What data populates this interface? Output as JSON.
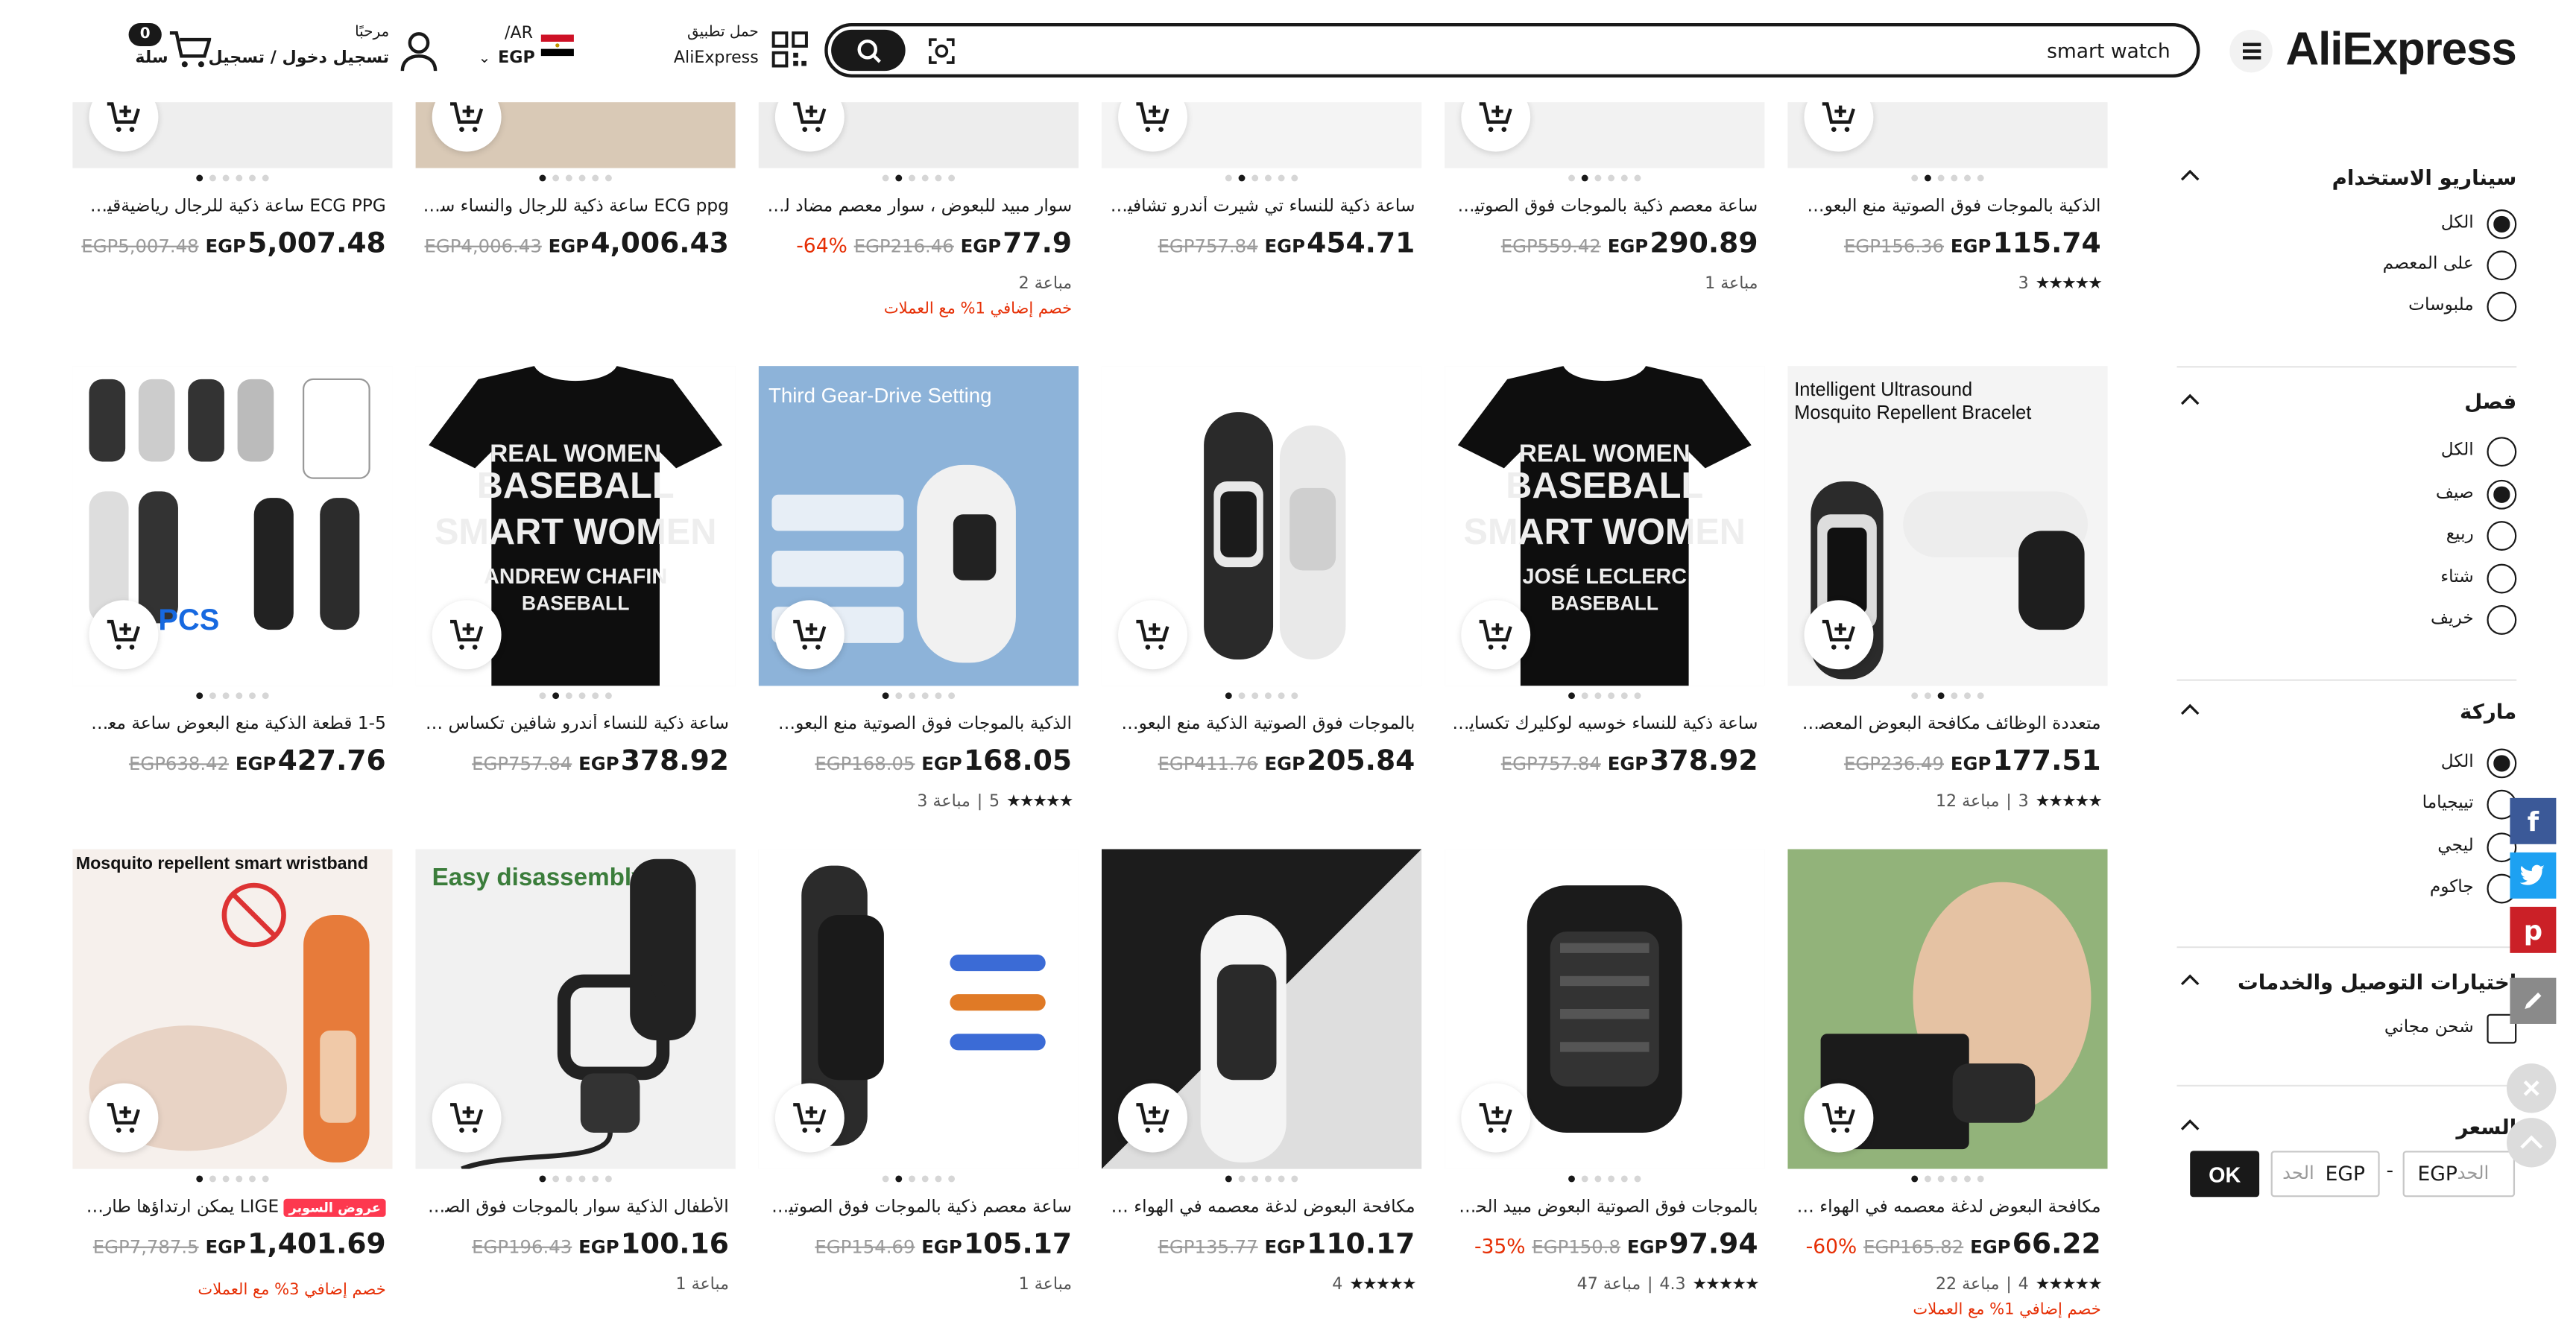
{
  "header": {
    "logo": "AliExpress",
    "search_value": "smart watch",
    "app_line1": "حمل تطبيق",
    "app_line2": "AliExpress",
    "lang_line1": "/AR",
    "lang_line2": "EGP",
    "welcome": "مرحبًا",
    "signin": "تسجيل دخول / تسجيل",
    "cart_count": "0",
    "cart_label": "سلة"
  },
  "filters": {
    "usage": {
      "title": "سيناريو الاستخدام",
      "options": [
        {
          "label": "الكل",
          "selected": true
        },
        {
          "label": "على المعصم",
          "selected": false
        },
        {
          "label": "ملبوسات",
          "selected": false
        }
      ]
    },
    "season": {
      "title": "فصل",
      "options": [
        {
          "label": "الكل",
          "selected": false
        },
        {
          "label": "صيف",
          "selected": true
        },
        {
          "label": "ربيع",
          "selected": false
        },
        {
          "label": "شتاء",
          "selected": false
        },
        {
          "label": "خريف",
          "selected": false
        }
      ]
    },
    "brand": {
      "title": "ماركة",
      "options": [
        {
          "label": "الكل",
          "selected": true
        },
        {
          "label": "تييجياما",
          "selected": false
        },
        {
          "label": "ليجي",
          "selected": false
        },
        {
          "label": "جاكوم",
          "selected": false
        }
      ]
    },
    "delivery": {
      "title": "اختيارات التوصيل والخدمات",
      "options": [
        {
          "label": "شحن مجاني",
          "selected": false
        }
      ]
    },
    "price": {
      "title": "السعر",
      "min_prefix": "EGP",
      "min_placeholder": "الحد",
      "max_prefix": "EGP",
      "max_placeholder": "الحد",
      "sep": "-",
      "ok": "OK"
    }
  },
  "products": [
    {
      "title": "الذكية بالموجات فوق الصوتية منع البعوض ...",
      "price": "115.74",
      "currency": "EGP",
      "old_price": "EGP156.36",
      "rating": "3",
      "sold": "",
      "discount": "",
      "promo": ""
    },
    {
      "title": "ساعة معصم ذكية بالموجات فوق الصوتية للأط",
      "price": "290.89",
      "currency": "EGP",
      "old_price": "EGP559.42",
      "rating": "",
      "sold": "1 مباعة",
      "discount": "",
      "promo": ""
    },
    {
      "title": "ساعة ذكية للنساء تي شيرت أندرو تشافين تك...",
      "price": "454.71",
      "currency": "EGP",
      "old_price": "EGP757.84",
      "rating": "",
      "sold": "",
      "discount": "",
      "promo": ""
    },
    {
      "title": "سوار مبيد للبعوض ، سوار معصم مضاد للبعـ...",
      "price": "77.9",
      "currency": "EGP",
      "old_price": "EGP216.46",
      "rating": "",
      "sold": "2 مباعة",
      "discount": "-64%",
      "promo": "خصم إضافي 1% مع العملات"
    },
    {
      "title": "ECG ppg ساعة ذكية للرجال والنساء ساعـ...",
      "price": "4,006.43",
      "currency": "EGP",
      "old_price": "EGP4,006.43",
      "rating": "",
      "sold": "",
      "discount": "",
      "promo": ""
    },
    {
      "title": "ECG PPG ساعة ذكية للرجال رياضيةقيق...",
      "price": "5,007.48",
      "currency": "EGP",
      "old_price": "EGP5,007.48",
      "rating": "",
      "sold": "",
      "discount": "",
      "promo": ""
    },
    {
      "title": "متعددة الوظائف مكافحة البعوض المعصم الق...",
      "price": "177.51",
      "currency": "EGP",
      "old_price": "EGP236.49",
      "rating": "3",
      "sold": "12 مباعة",
      "discount": "",
      "promo": ""
    },
    {
      "title": "ساعة ذكية للنساء خوسيه لوكليرك تكسايسيو...",
      "price": "378.92",
      "currency": "EGP",
      "old_price": "EGP757.84",
      "rating": "",
      "sold": "",
      "discount": "",
      "promo": ""
    },
    {
      "title": "بالموجات فوق الصوتية الذكية منع البعوض ...",
      "price": "205.84",
      "currency": "EGP",
      "old_price": "EGP411.76",
      "rating": "",
      "sold": "",
      "discount": "",
      "promo": ""
    },
    {
      "title": "الذكية بالموجات فوق الصوتية منع البعوض ...",
      "price": "168.05",
      "currency": "EGP",
      "old_price": "EGP168.05",
      "rating": "5",
      "sold": "3 مباعة",
      "discount": "",
      "promo": ""
    },
    {
      "title": "ساعة ذكية للنساء أندرو شافين تكساس بيسبو...",
      "price": "378.92",
      "currency": "EGP",
      "old_price": "EGP757.84",
      "rating": "",
      "sold": "",
      "discount": "",
      "promo": ""
    },
    {
      "title": "1-5 قطعة الذكية منع البعوض ساعة معصم ...",
      "price": "427.76",
      "currency": "EGP",
      "old_price": "EGP638.42",
      "rating": "",
      "sold": "",
      "discount": "",
      "promo": ""
    },
    {
      "title": "مكافحة البعوض لدغة معصمه في الهواء الطلـ...",
      "price": "66.22",
      "currency": "EGP",
      "old_price": "EGP165.82",
      "rating": "4",
      "sold": "22 مباعة",
      "discount": "-60%",
      "promo": "خصم إضافي 1% مع العملات"
    },
    {
      "title": "بالموجات فوق الصوتية البعوض مبيد الحشرا...",
      "price": "97.94",
      "currency": "EGP",
      "old_price": "EGP150.8",
      "rating": "4.3",
      "sold": "47 مباعة",
      "discount": "-35%",
      "promo": ""
    },
    {
      "title": "مكافحة البعوض لدغة معصمه في الهواء الطلـ...",
      "price": "110.17",
      "currency": "EGP",
      "old_price": "EGP135.77",
      "rating": "4",
      "sold": "",
      "discount": "",
      "promo": ""
    },
    {
      "title": "ساعة معصم ذكية بالموجات فوق الصوتية ـمـ...",
      "price": "105.17",
      "currency": "EGP",
      "old_price": "EGP154.69",
      "rating": "",
      "sold": "1 مباعة",
      "discount": "",
      "promo": ""
    },
    {
      "title": "الأطفال الذكية سوار بالموجات فوق الصوتيةط...",
      "price": "100.16",
      "currency": "EGP",
      "old_price": "EGP196.43",
      "rating": "",
      "sold": "1 مباعة",
      "discount": "",
      "promo": ""
    },
    {
      "title": "LIGE يمكن ارتداؤها طارد لبعـ...",
      "price": "1,401.69",
      "currency": "EGP",
      "old_price": "EGP7,787.5",
      "rating": "",
      "sold": "",
      "discount": "",
      "promo": "خصم إضافي 3% مع العملات",
      "super": "عروض السوبر"
    }
  ],
  "image_text": {
    "p9": "Third Gear-Drive Setting",
    "p7": "Intelligent Ultrasound\nMosquito Repellent Bracelet",
    "p18": "Mosquito repellent smart wristband",
    "p17": "Easy disassembly",
    "tshirt_a": "REAL WOMEN\nBASEBALL\nSMART WOMEN\nANDREW CHAFIN\nBASEBALL",
    "tshirt_b": "REAL WOMEN\nBASEBALL\nSMART WOMEN\nJOSÉ LECLERC\nBASEBALL",
    "pcs": "PCS"
  },
  "social": [
    "f",
    "t",
    "p",
    "edit"
  ],
  "colors": {
    "accent": "#e62e04",
    "brand_red": "#fd384f",
    "facebook": "#3b5998",
    "twitter": "#1da1f2",
    "pinterest": "#cb2027",
    "dark": "#191919"
  }
}
